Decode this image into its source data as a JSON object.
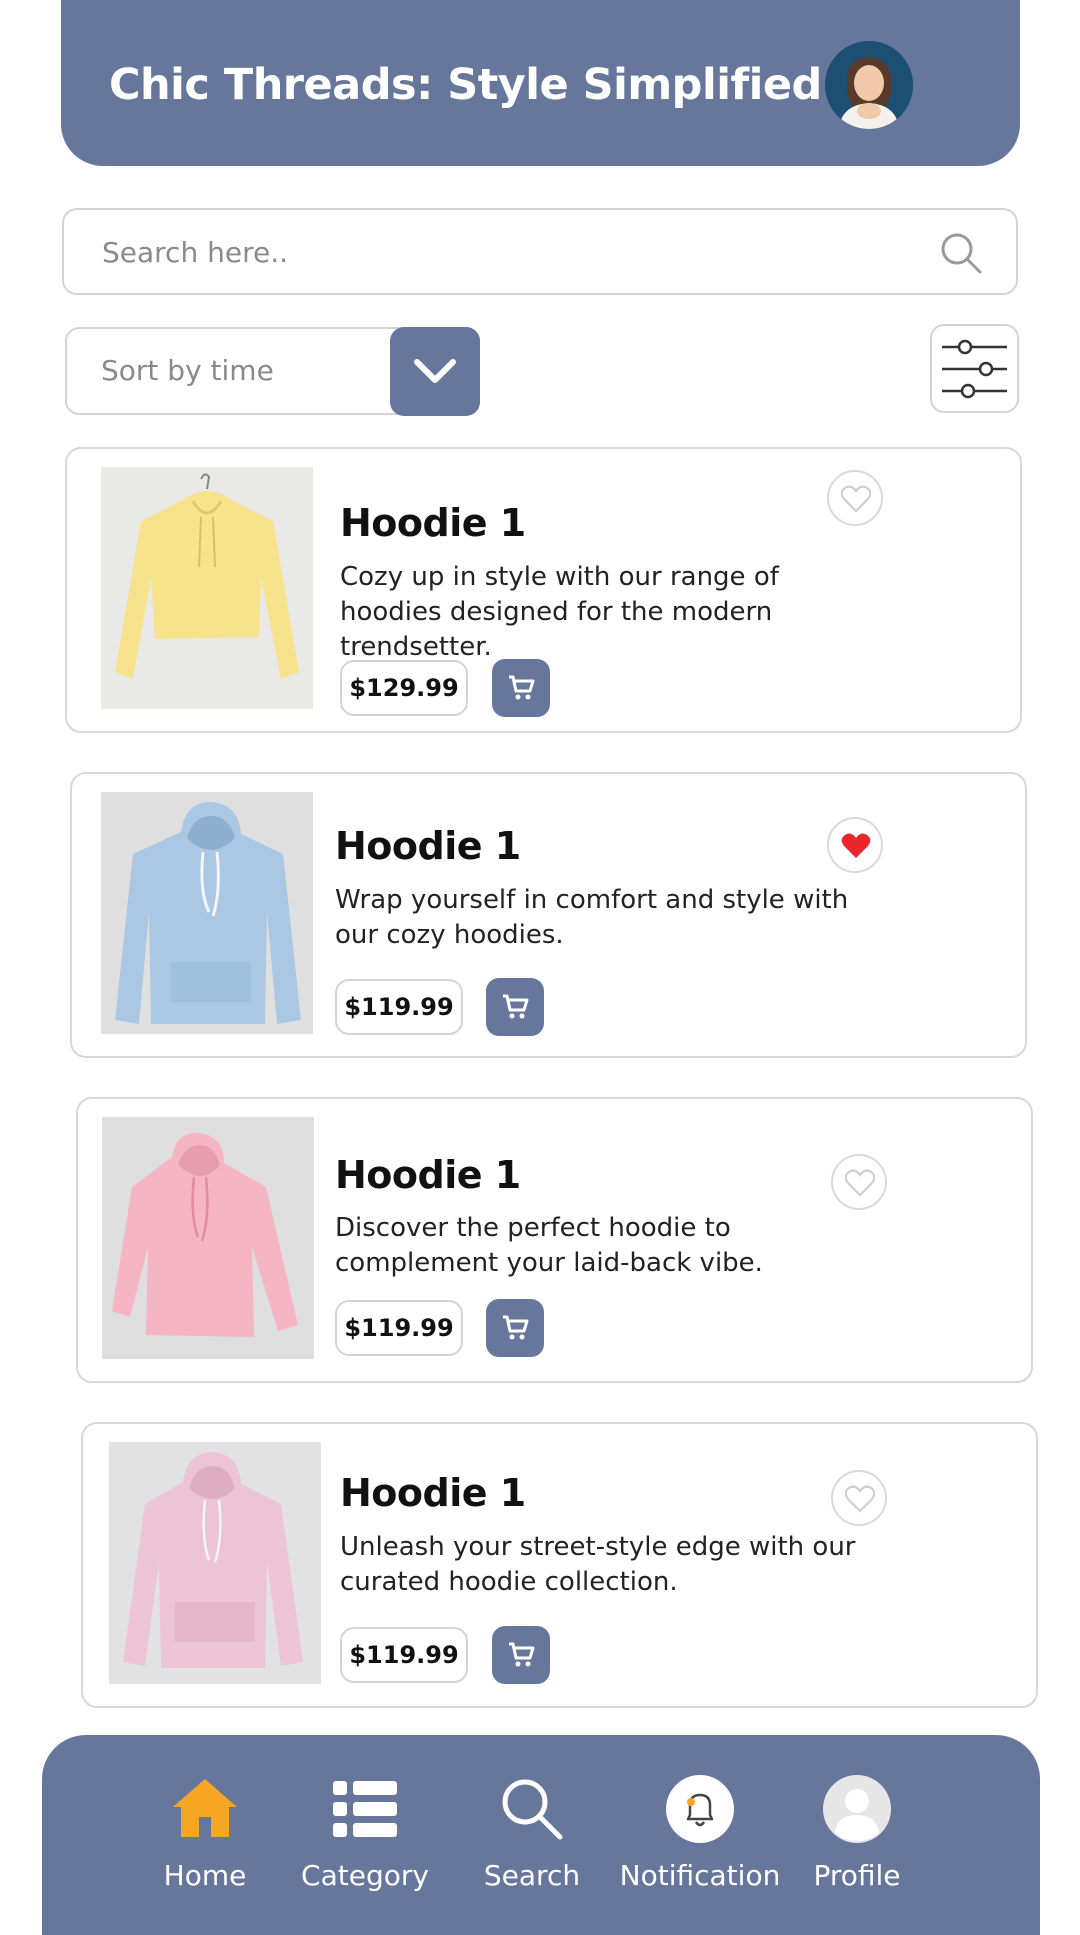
{
  "header": {
    "title": "Chic Threads: Style Simplified"
  },
  "search": {
    "placeholder": "Search here.."
  },
  "sort": {
    "label": "Sort by time"
  },
  "products": [
    {
      "name": "Hoodie 1",
      "description": "Cozy up in style with our range of hoodies designed for the modern trendsetter.",
      "price": "$129.99",
      "favorited": false,
      "color": "#f6e38b"
    },
    {
      "name": "Hoodie 1",
      "description": "Wrap yourself in comfort and style with our cozy hoodies.",
      "price": "$119.99",
      "favorited": true,
      "color": "#aac8e3"
    },
    {
      "name": "Hoodie 1",
      "description": "Discover the perfect hoodie to complement your laid-back vibe.",
      "price": "$119.99",
      "favorited": false,
      "color": "#f5b5c5"
    },
    {
      "name": "Hoodie 1",
      "description": "Unleash your street-style edge with our curated hoodie collection.",
      "price": "$119.99",
      "favorited": false,
      "color": "#ecc4d4"
    }
  ],
  "nav": [
    {
      "label": "Home",
      "icon": "home-icon",
      "active": true
    },
    {
      "label": "Category",
      "icon": "list-icon"
    },
    {
      "label": "Search",
      "icon": "search-icon"
    },
    {
      "label": "Notification",
      "icon": "bell-icon"
    },
    {
      "label": "Profile",
      "icon": "user-icon"
    }
  ],
  "colors": {
    "primary": "#67779c",
    "accent": "#f5a623",
    "favorite": "#e8262c",
    "border": "#d4d4d4"
  }
}
